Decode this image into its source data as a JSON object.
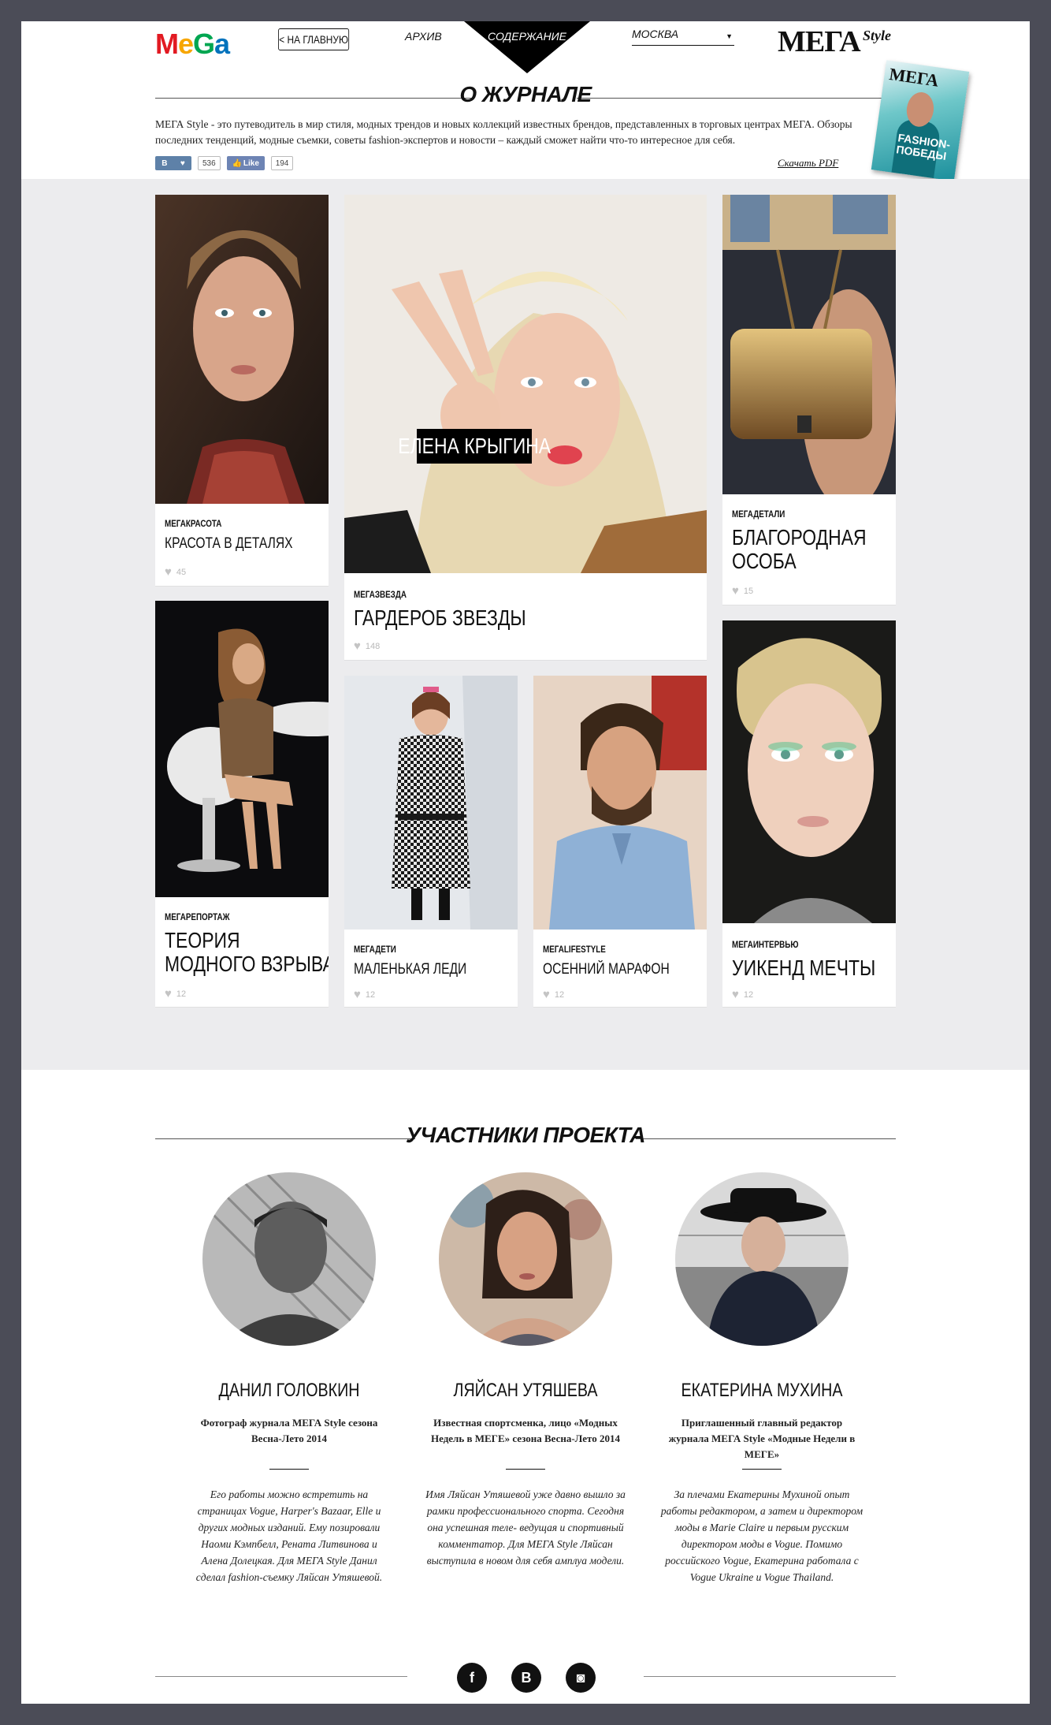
{
  "header": {
    "logo": "MeGa",
    "home_label": "НА ГЛАВНУЮ",
    "archive_label": "АРХИВ",
    "contents_label": "СОДЕРЖАНИЕ",
    "city": "МОСКВА",
    "brand": "МЕГА",
    "brand_sub": "Style"
  },
  "about": {
    "title": "О ЖУРНАЛЕ",
    "text": "МЕГА Style - это путеводитель в мир стиля, модных трендов и новых коллекций известных брендов, представленных в торговых центрах МЕГА. Обзоры последних тенденций, модные съемки, советы fashion-экспертов и новости – каждый сможет найти что-то интересное для себя.",
    "vk_count": "536",
    "fb_like_label": "Like",
    "fb_count": "194",
    "pdf_label": "Скачать PDF",
    "cover_title": "МЕГА",
    "cover_caption": "FASHION-ПОБЕДЫ"
  },
  "cards": [
    {
      "category": "МЕГАКРАСОТА",
      "title": "КРАСОТА В ДЕТАЛЯХ",
      "likes": "45"
    },
    {
      "category": "МЕГАЗВЕЗДА",
      "title": "ГАРДЕРОБ ЗВЕЗДЫ",
      "likes": "148",
      "overlay": "ЕЛЕНА КРЫГИНА"
    },
    {
      "category": "МЕГАДЕТАЛИ",
      "title": "БЛАГОРОДНАЯ",
      "title2": "ОСОБА",
      "likes": "15"
    },
    {
      "category": "МЕГАРЕПОРТАЖ",
      "title": "ТЕОРИЯ",
      "title2": "МОДНОГО ВЗРЫВА",
      "likes": "12"
    },
    {
      "category": "МЕГАДЕТИ",
      "title": "МАЛЕНЬКАЯ ЛЕДИ",
      "likes": "12"
    },
    {
      "category": "МЕГАLIFESTYLE",
      "title": "ОСЕННИЙ МАРАФОН",
      "likes": "12"
    },
    {
      "category": "МЕГАИНТЕРВЬЮ",
      "title": "УИКЕНД МЕЧТЫ",
      "likes": "12"
    }
  ],
  "participants": {
    "title": "УЧАСТНИКИ ПРОЕКТА",
    "people": [
      {
        "name": "ДАНИЛ ГОЛОВКИН",
        "role": "Фотограф журнала МЕГА Style сезона Весна-Лето 2014",
        "bio": "Его работы можно встретить на страницах Vogue, Harper's Bazaar, Elle и других модных изданий. Ему позировали Наоми Кэмпбелл, Рената Литвинова и Алена Долецкая. Для МЕГА Style Данил сделал fashion-съемку Ляйсан Утяшевой."
      },
      {
        "name": "ЛЯЙСАН УТЯШЕВА",
        "role": "Известная спортсменка, лицо «Модных Недель в МЕГЕ» сезона Весна-Лето 2014",
        "bio": "Имя Ляйсан Утяшевой уже давно вышло за рамки профессионального спорта. Сегодня она успешная теле- ведущая и спортивный комментатор. Для МЕГА Style Ляйсан выступила в новом для себя амплуа модели."
      },
      {
        "name": "ЕКАТЕРИНА МУХИНА",
        "role": "Приглашенный главный редактор журнала МЕГА Style «Модные Недели в МЕГЕ»",
        "bio": "За плечами Екатерины Мухиной опыт работы редактором, а затем и директором моды в Marie Claire и первым русским директором моды в Vogue. Помимо российского Vogue, Екатерина работала с Vogue Ukraine и Vogue Thailand."
      }
    ]
  },
  "footer": {
    "facebook": "f",
    "vk": "B",
    "instagram": "◙"
  },
  "colors": {
    "frame": "#4b4c57",
    "grid_bg": "#ececee",
    "vk_blue": "#5e81a8",
    "fb_blue": "#6d84b4"
  }
}
